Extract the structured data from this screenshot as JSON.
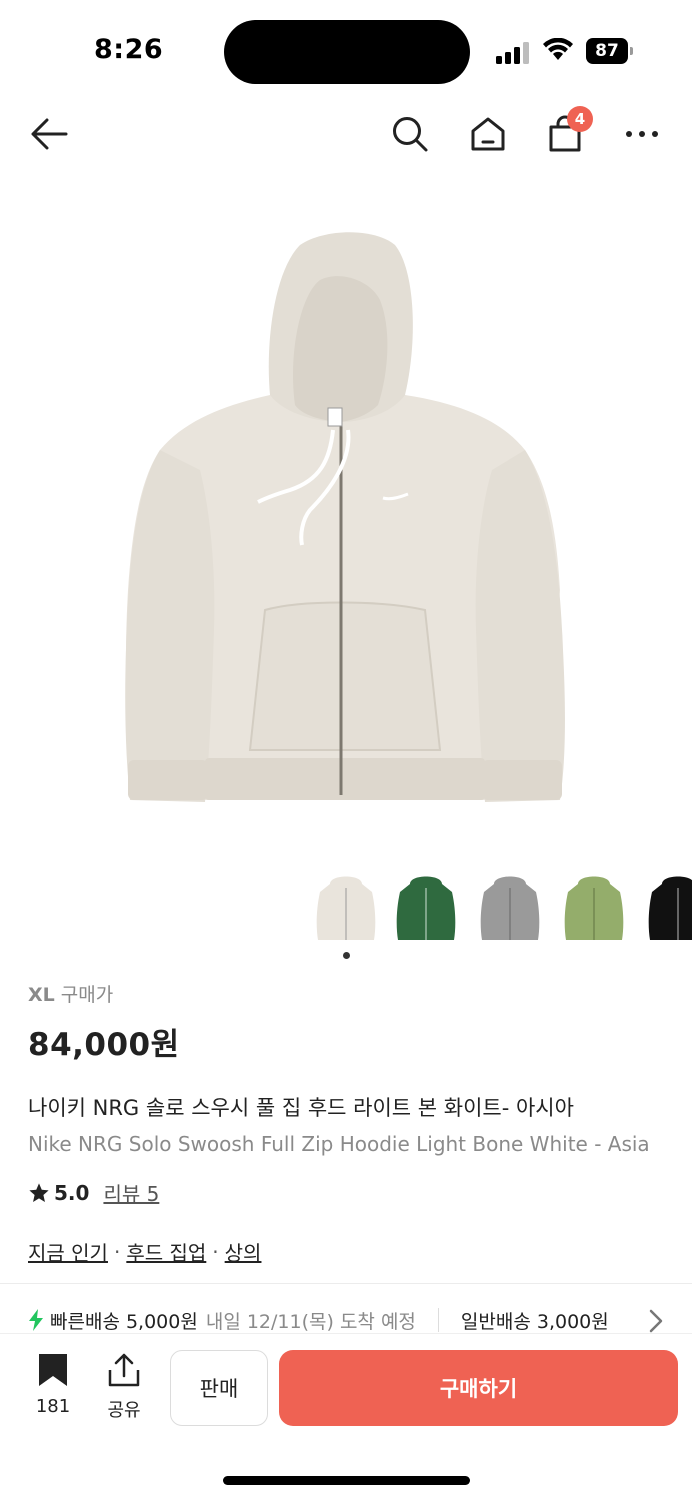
{
  "status_bar": {
    "time": "8:26",
    "battery": "87"
  },
  "nav": {
    "cart_count": "4"
  },
  "product": {
    "size_label": "XL",
    "price_label": "구매가",
    "price": "84,000원",
    "name_ko": "나이키 NRG 솔로 스우시 풀 집 후드 라이트 본 화이트- 아시아",
    "name_en": "Nike NRG Solo Swoosh Full Zip Hoodie Light Bone White - Asia",
    "rating": "5.0",
    "review_label": "리뷰 5",
    "tags": [
      "지금 인기",
      "후드 집업",
      "상의"
    ],
    "tag_separator": "·"
  },
  "thumbnails": [
    {
      "color": "#e9e4dc",
      "name": "light-bone"
    },
    {
      "color": "#2f6a3f",
      "name": "green"
    },
    {
      "color": "#9a9a9a",
      "name": "grey"
    },
    {
      "color": "#94ad6b",
      "name": "olive"
    },
    {
      "color": "#111111",
      "name": "black"
    }
  ],
  "shipping": {
    "fast_label": "빠른배송 5,000원",
    "fast_eta": "내일 12/11(목) 도착 예정",
    "normal_label": "일반배송 3,000원"
  },
  "bottom_bar": {
    "bookmark_count": "181",
    "share_label": "공유",
    "sell_label": "판매",
    "buy_label": "구매하기"
  },
  "colors": {
    "accent": "#ef6253",
    "product": "#e9e4dc",
    "fast_ship": "#22c55e"
  }
}
